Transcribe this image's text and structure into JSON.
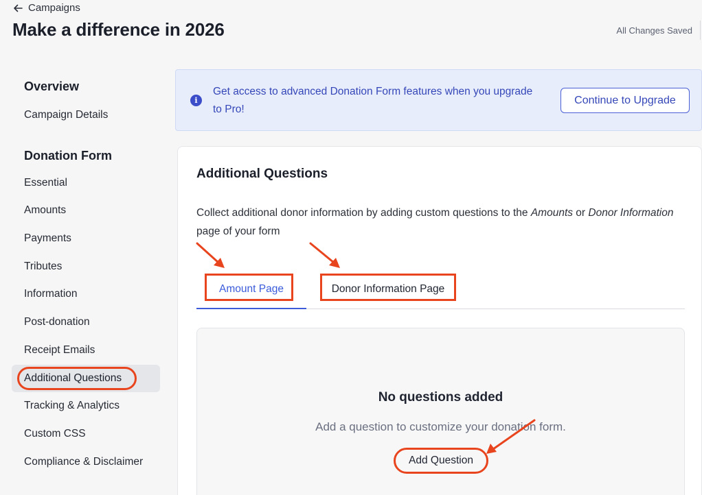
{
  "header": {
    "back_label": "Campaigns",
    "title": "Make a difference in 2026",
    "save_status": "All Changes Saved"
  },
  "sidebar": {
    "overview_heading": "Overview",
    "campaign_details": "Campaign Details",
    "donation_form_heading": "Donation Form",
    "items": [
      "Essential",
      "Amounts",
      "Payments",
      "Tributes",
      "Information",
      "Post-donation",
      "Receipt Emails",
      "Additional Questions",
      "Tracking & Analytics",
      "Custom CSS",
      "Compliance & Disclaimer"
    ],
    "active_item": "Additional Questions"
  },
  "banner": {
    "icon": "info-icon",
    "text": "Get access to advanced Donation Form features when you upgrade to Pro!",
    "button_label": "Continue to Upgrade"
  },
  "main": {
    "title": "Additional Questions",
    "desc_part1": "Collect additional donor information by adding custom questions to the ",
    "desc_em1": "Amounts",
    "desc_part2": " or ",
    "desc_em2": "Donor Information",
    "desc_part3": " page of your form",
    "tabs": [
      {
        "label": "Amount Page",
        "active": true
      },
      {
        "label": "Donor Information Page",
        "active": false
      }
    ],
    "empty_title": "No questions added",
    "empty_subtitle": "Add a question to customize your donation form.",
    "add_button_label": "Add Question"
  },
  "colors": {
    "accent": "#3b5bdb",
    "annotation": "#e8441e",
    "banner_bg": "#e7edfb"
  }
}
